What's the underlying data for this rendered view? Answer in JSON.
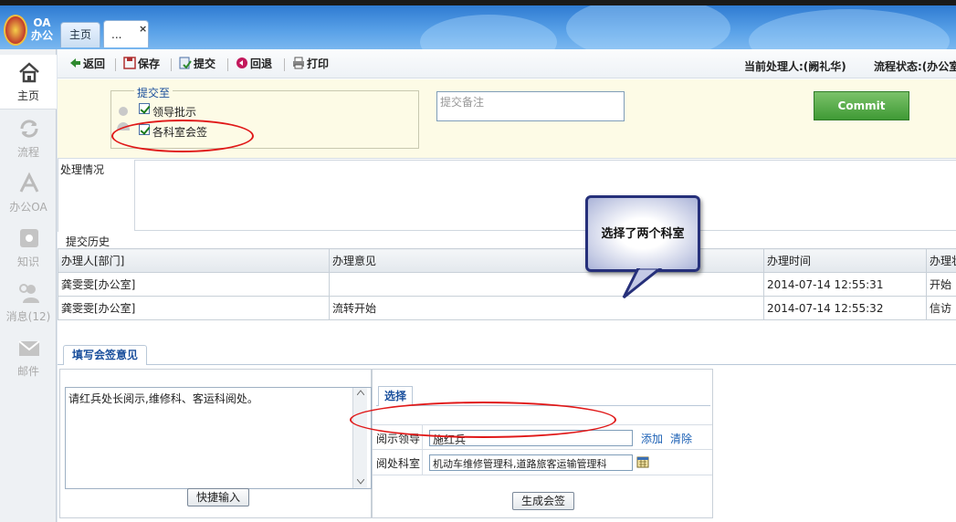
{
  "app": {
    "logo_text_line1": "OA",
    "logo_text_line2": "办公"
  },
  "tabs": {
    "home": "主页",
    "current": "...",
    "close": "×"
  },
  "sidebar": {
    "items": [
      {
        "label": "主页",
        "icon": "home-icon",
        "active": true
      },
      {
        "label": "流程",
        "icon": "workflow-icon",
        "active": false
      },
      {
        "label": "办公OA",
        "icon": "office-icon",
        "active": false
      },
      {
        "label": "知识",
        "icon": "knowledge-icon",
        "active": false
      },
      {
        "label": "消息(12)",
        "icon": "message-icon",
        "active": false
      },
      {
        "label": "邮件",
        "icon": "mail-icon",
        "active": false
      }
    ]
  },
  "toolbar": {
    "back": "返回",
    "save": "保存",
    "submit": "提交",
    "rollback": "回退",
    "print": "打印",
    "handler": "当前处理人:(阙礼华)",
    "flow_state": "流程状态:(办公室"
  },
  "submit_panel": {
    "legend": "提交至",
    "options": [
      {
        "label": "领导批示",
        "checked": true
      },
      {
        "label": "各科室会签",
        "checked": true
      }
    ],
    "remark_placeholder": "提交备注",
    "commit_label": "Commit"
  },
  "processing": {
    "label": "处理情况"
  },
  "history": {
    "label": "提交历史",
    "columns": [
      "办理人[部门]",
      "办理意见",
      "办理时间",
      "办理状"
    ],
    "rows": [
      [
        "龚雯雯[办公室]",
        "",
        "2014-07-14 12:55:31",
        "开始"
      ],
      [
        "龚雯雯[办公室]",
        "流转开始",
        "2014-07-14 12:55:32",
        "信访"
      ]
    ]
  },
  "callout": {
    "text": "选择了两个科室"
  },
  "sign": {
    "tab_label": "填写会签意见",
    "opinion_text": "请红兵处长阅示,维修科、客运科阅处。",
    "quick_input": "快捷输入",
    "select_tab": "选择",
    "leader_label": "阅示领导",
    "leader_value": "施红兵",
    "add": "添加",
    "clear": "清除",
    "dept_label": "阅处科室",
    "dept_value": "机动车维修管理科,道路旅客运输管理科",
    "generate": "生成会签"
  }
}
